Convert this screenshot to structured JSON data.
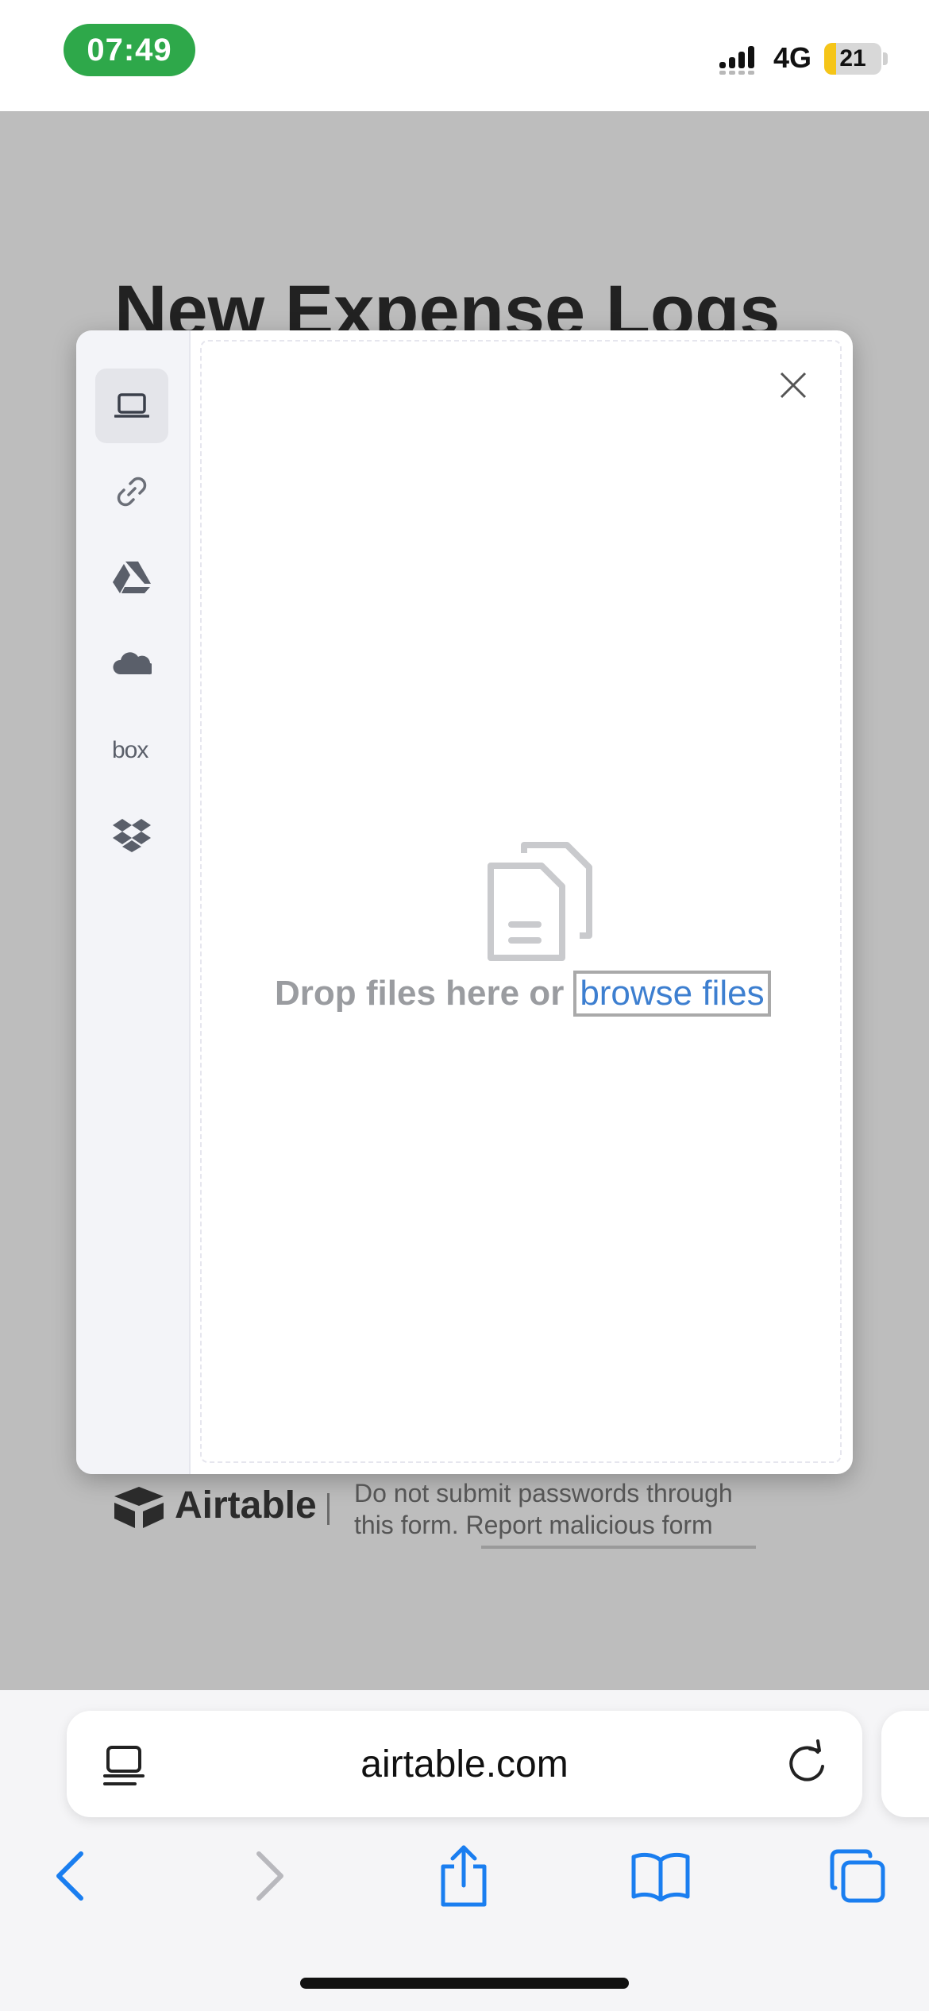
{
  "status_bar": {
    "time": "07:49",
    "network": "4G",
    "battery": "21",
    "battery_fraction": 0.21
  },
  "page": {
    "title": "New Expense Logs"
  },
  "upload_modal": {
    "sources": [
      {
        "icon": "laptop-icon",
        "active": true
      },
      {
        "icon": "link-icon"
      },
      {
        "icon": "google-drive-icon"
      },
      {
        "icon": "onedrive-cloud-icon"
      },
      {
        "icon": "box-logo-icon",
        "label": "box"
      },
      {
        "icon": "dropbox-icon"
      }
    ],
    "drop_text": "Drop files here or",
    "browse_link": "browse files",
    "close_icon": "close-icon"
  },
  "footer": {
    "brand": "Airtable",
    "separator": "|",
    "notice_line1": "Do not submit passwords through",
    "notice_line2_prefix": "this form. ",
    "report_link": "Report malicious form"
  },
  "browser": {
    "url": "airtable.com"
  },
  "colors": {
    "accent": "#3d7fd0",
    "status_green": "#2ea84a",
    "battery_yellow": "#f5c518",
    "ios_blue": "#1a7ef0"
  }
}
